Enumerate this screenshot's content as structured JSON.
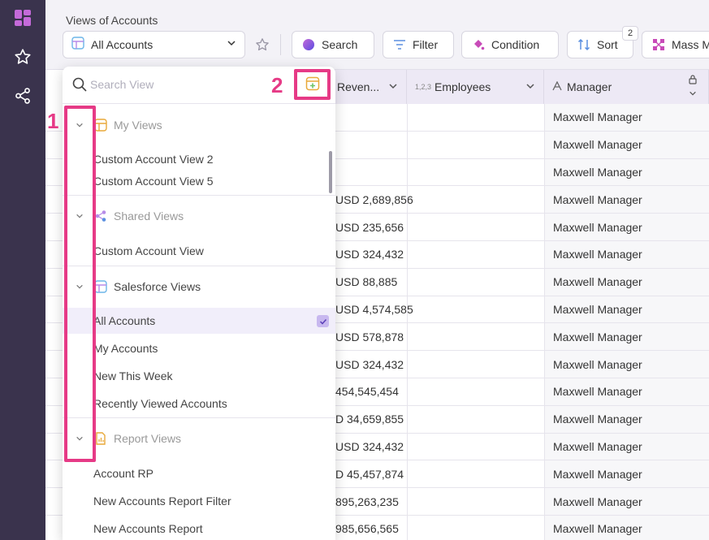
{
  "toolbar": {
    "views_label": "Views of Accounts",
    "selected_view": "All Accounts",
    "search_label": "Search",
    "filter_label": "Filter",
    "condition_label": "Condition",
    "sort_label": "Sort",
    "sort_count": "2",
    "mass_label": "Mass M"
  },
  "columns": {
    "revenue": "Reven...",
    "employees": "Employees",
    "employees_prefix": "1,2,3",
    "manager": "Manager"
  },
  "rows": [
    {
      "revenue": "",
      "manager": "Maxwell Manager"
    },
    {
      "revenue": "",
      "manager": "Maxwell Manager"
    },
    {
      "revenue": "",
      "manager": "Maxwell Manager"
    },
    {
      "revenue": "USD 2,689,856",
      "manager": "Maxwell Manager"
    },
    {
      "revenue": "USD 235,656",
      "manager": "Maxwell Manager"
    },
    {
      "revenue": "USD 324,432",
      "manager": "Maxwell Manager"
    },
    {
      "revenue": "USD 88,885",
      "manager": "Maxwell Manager"
    },
    {
      "revenue": "USD 4,574,585",
      "manager": "Maxwell Manager"
    },
    {
      "revenue": "USD 578,878",
      "manager": "Maxwell Manager"
    },
    {
      "revenue": "USD 324,432",
      "manager": "Maxwell Manager"
    },
    {
      "revenue": "454,545,454",
      "manager": "Maxwell Manager"
    },
    {
      "revenue": "D 34,659,855",
      "manager": "Maxwell Manager"
    },
    {
      "revenue": "USD 324,432",
      "manager": "Maxwell Manager"
    },
    {
      "revenue": "D 45,457,874",
      "manager": "Maxwell Manager"
    },
    {
      "revenue": "895,263,235",
      "manager": "Maxwell Manager"
    },
    {
      "revenue": "985,656,565",
      "manager": "Maxwell Manager"
    }
  ],
  "panel": {
    "search_placeholder": "Search View",
    "sections": {
      "my_views": {
        "label": "My Views",
        "items": [
          "Custom Account View 2",
          "Custom Account View 5"
        ]
      },
      "shared_views": {
        "label": "Shared Views",
        "items": [
          "Custom Account View"
        ]
      },
      "salesforce_views": {
        "label": "Salesforce Views",
        "items": [
          "All Accounts",
          "My Accounts",
          "New This Week",
          "Recently Viewed Accounts"
        ]
      },
      "report_views": {
        "label": "Report Views",
        "items": [
          "Account RP",
          "New Accounts Report Filter",
          "New Accounts Report"
        ]
      }
    }
  },
  "annotations": {
    "one": "1",
    "two": "2"
  },
  "colors": {
    "rail": "#3a334d",
    "accent": "#e63a86",
    "header_bg": "#ede9f5"
  }
}
